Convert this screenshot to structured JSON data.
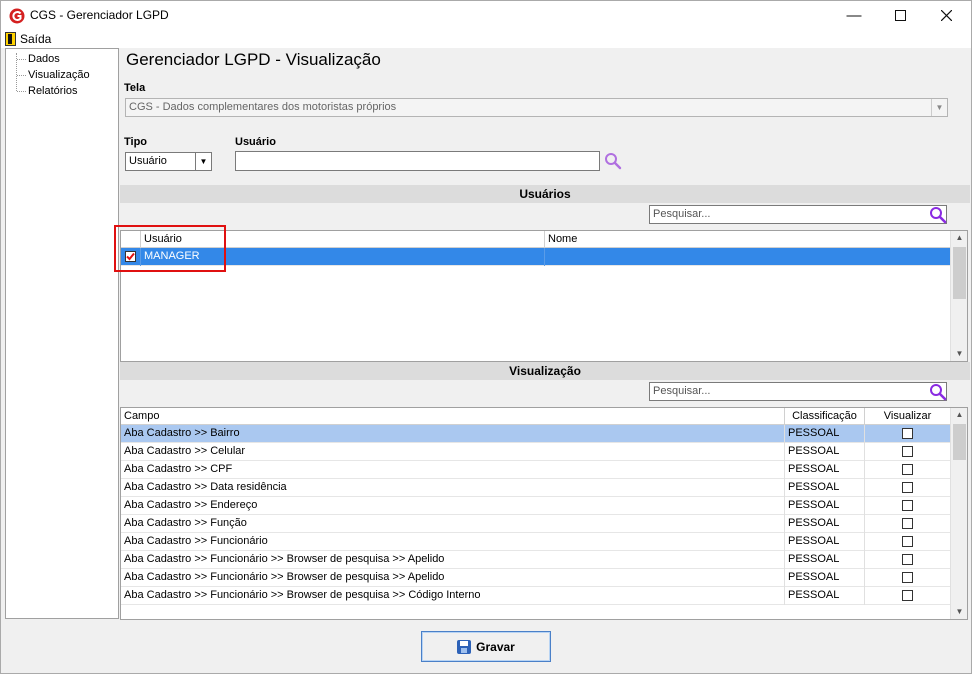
{
  "window": {
    "title": "CGS - Gerenciador LGPD"
  },
  "menu": {
    "saida": "Saída"
  },
  "tree": {
    "items": [
      "Dados",
      "Visualização",
      "Relatórios"
    ]
  },
  "main": {
    "heading": "Gerenciador LGPD - Visualização",
    "tela_label": "Tela",
    "tela_value": "CGS - Dados complementares dos motoristas próprios",
    "tipo_label": "Tipo",
    "tipo_value": "Usuário",
    "usuario_label": "Usuário",
    "usuario_value": ""
  },
  "usuarios": {
    "section_title": "Usuários",
    "search_placeholder": "Pesquisar...",
    "columns": [
      "Usuário",
      "Nome"
    ],
    "rows": [
      {
        "checked": true,
        "usuario": "MANAGER",
        "nome": ""
      }
    ]
  },
  "visualizacao": {
    "section_title": "Visualização",
    "search_placeholder": "Pesquisar...",
    "columns": [
      "Campo",
      "Classificação",
      "Visualizar"
    ],
    "rows": [
      {
        "campo": "Aba Cadastro >> Bairro",
        "classificacao": "PESSOAL",
        "visualizar": false
      },
      {
        "campo": "Aba Cadastro >> Celular",
        "classificacao": "PESSOAL",
        "visualizar": false
      },
      {
        "campo": "Aba Cadastro >> CPF",
        "classificacao": "PESSOAL",
        "visualizar": false
      },
      {
        "campo": "Aba Cadastro >> Data residência",
        "classificacao": "PESSOAL",
        "visualizar": false
      },
      {
        "campo": "Aba Cadastro >> Endereço",
        "classificacao": "PESSOAL",
        "visualizar": false
      },
      {
        "campo": "Aba Cadastro >> Função",
        "classificacao": "PESSOAL",
        "visualizar": false
      },
      {
        "campo": "Aba Cadastro >> Funcionário",
        "classificacao": "PESSOAL",
        "visualizar": false
      },
      {
        "campo": "Aba Cadastro >> Funcionário >> Browser de pesquisa >> Apelido",
        "classificacao": "PESSOAL",
        "visualizar": false
      },
      {
        "campo": "Aba Cadastro >> Funcionário >> Browser de pesquisa >> Apelido",
        "classificacao": "PESSOAL",
        "visualizar": false
      },
      {
        "campo": "Aba Cadastro >> Funcionário >> Browser de pesquisa >> Código Interno",
        "classificacao": "PESSOAL",
        "visualizar": false
      }
    ]
  },
  "footer": {
    "gravar_label": "Gravar"
  },
  "colors": {
    "selection": "#3388e8",
    "highlight_border": "#e01010",
    "search_icon": "#8a2be2"
  }
}
